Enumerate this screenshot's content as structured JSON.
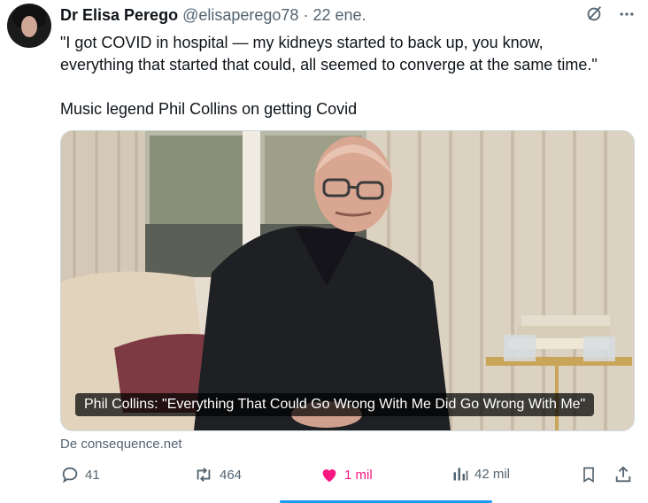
{
  "tweet": {
    "author_name": "Dr Elisa Perego",
    "author_handle": "@elisaperego78",
    "separator": "·",
    "date": "22 ene.",
    "text_lines": [
      "\"I got COVID in hospital — my kidneys started to back up, you know,",
      "everything that started that could, all seemed to converge at the same time.\"",
      "",
      "Music legend Phil Collins on getting Covid"
    ]
  },
  "card": {
    "caption": "Phil Collins: \"Everything That Could Go Wrong With Me Did Go Wrong With Me\"",
    "source": "De consequence.net"
  },
  "actions": {
    "replies": "41",
    "retweets": "464",
    "likes": "1 mil",
    "views": "42 mil"
  },
  "colors": {
    "like": "#f91880",
    "muted": "#536471",
    "accent": "#1d9bf0"
  },
  "icons": [
    "grok-icon",
    "more-icon",
    "reply-icon",
    "retweet-icon",
    "heart-icon",
    "views-icon",
    "bookmark-icon",
    "share-icon"
  ]
}
